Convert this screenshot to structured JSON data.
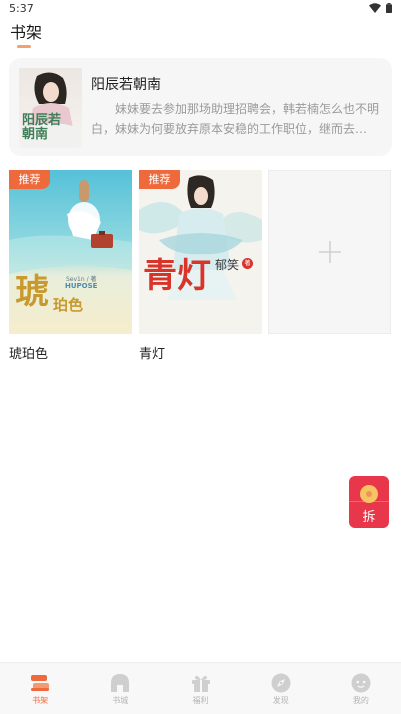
{
  "status_bar": {
    "time": "5:37",
    "icons": [
      "wifi-icon",
      "battery-icon"
    ]
  },
  "header": {
    "title": "书架"
  },
  "featured": {
    "title": "阳辰若朝南",
    "description": "妹妹要去参加那场助理招聘会，韩若楠怎么也不明白，妹妹为何要放弃原本安稳的工作职位，继而去…",
    "cover_text": "阳辰若朝南"
  },
  "books": [
    {
      "title": "琥珀色",
      "badge": "推荐",
      "cover_big": "琥",
      "cover_small": "珀色",
      "cover_author": "Sev1n / 著",
      "cover_en": "HUPOSE"
    },
    {
      "title": "青灯",
      "badge": "推荐",
      "cover_big": "青灯",
      "cover_author": "郁笑",
      "cover_seal": "著"
    }
  ],
  "add_book": {
    "icon": "plus-icon"
  },
  "red_packet": {
    "label": "拆"
  },
  "bottom_nav": {
    "active": "书架",
    "items": [
      {
        "label": "书架",
        "icon": "bookshelf-icon"
      },
      {
        "label": "书城",
        "icon": "bookstore-icon"
      },
      {
        "label": "福利",
        "icon": "gift-icon"
      },
      {
        "label": "发现",
        "icon": "discover-icon"
      },
      {
        "label": "我的",
        "icon": "profile-icon"
      }
    ]
  },
  "colors": {
    "accent": "#ee6a3c",
    "indicator": "#f0a268",
    "card_bg": "#f6f6f6",
    "red_packet": "#e8364a",
    "muted_text": "#9a9a9a"
  }
}
